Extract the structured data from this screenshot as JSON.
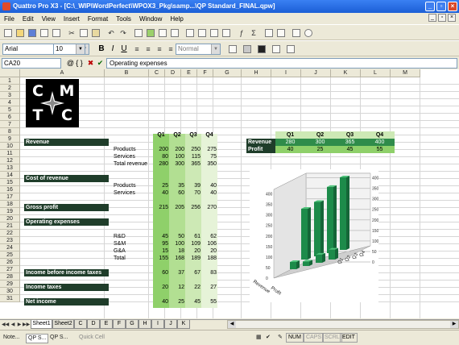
{
  "window": {
    "title": "Quattro Pro X3 - [C:\\_WIP\\WordPerfect\\WPOX3_Pkg\\samp...\\QP Standard_FINAL.qpw]"
  },
  "menu": [
    "File",
    "Edit",
    "View",
    "Insert",
    "Format",
    "Tools",
    "Window",
    "Help"
  ],
  "toolbar": {
    "font": "Arial",
    "size": "10",
    "style": "Normal",
    "bold": "B",
    "italic": "I",
    "underline": "U"
  },
  "input": {
    "cell_ref": "C A20",
    "cell_ref_text": "CA20",
    "at": "@",
    "braces": "{ }",
    "cancel": "✖",
    "confirm": "✔",
    "formula": "Operating expenses"
  },
  "columns": [
    "A",
    "B",
    "C",
    "D",
    "E",
    "F",
    "G",
    "H",
    "I",
    "J",
    "K",
    "L",
    "M"
  ],
  "rows": [
    "1",
    "2",
    "3",
    "4",
    "5",
    "6",
    "7",
    "8",
    "9",
    "10",
    "11",
    "12",
    "13",
    "14",
    "15",
    "16",
    "17",
    "18",
    "19",
    "20",
    "21",
    "22",
    "23",
    "24",
    "25",
    "26",
    "27",
    "28",
    "29",
    "30",
    "31"
  ],
  "logo": {
    "letters": [
      "C",
      "M",
      "T",
      "C"
    ]
  },
  "sheet": {
    "headers": [
      "Q1",
      "Q2",
      "Q3",
      "Q4"
    ],
    "revenue_label": "Revenue",
    "products_label": "Products",
    "services_label": "Services",
    "total_revenue_label": "Total revenue",
    "products_values": [
      "200",
      "200",
      "250",
      "275"
    ],
    "services_values": [
      "80",
      "100",
      "115",
      "75"
    ],
    "total_revenue_values": [
      "280",
      "300",
      "365",
      "350"
    ],
    "cost_label": "Cost of revenue",
    "cost_products_values": [
      "25",
      "35",
      "39",
      "40"
    ],
    "cost_services_values": [
      "40",
      "60",
      "70",
      "40"
    ],
    "gross_label": "Gross profit",
    "gross_values": [
      "215",
      "205",
      "256",
      "270"
    ],
    "opex_label": "Operating expenses",
    "rd_label": "R&D",
    "sm_label": "S&M",
    "ga_label": "G&A",
    "total_label": "Total",
    "rd_values": [
      "45",
      "50",
      "61",
      "62"
    ],
    "sm_values": [
      "95",
      "100",
      "109",
      "106"
    ],
    "ga_values": [
      "15",
      "18",
      "20",
      "20"
    ],
    "total_values": [
      "155",
      "168",
      "189",
      "188"
    ],
    "ebit_label": "Income before income taxes",
    "ebit_values": [
      "60",
      "37",
      "67",
      "83"
    ],
    "tax_label": "Income taxes",
    "tax_values": [
      "20",
      "12",
      "22",
      "27"
    ],
    "net_label": "Net income",
    "net_values": [
      "40",
      "25",
      "45",
      "55"
    ]
  },
  "summary": {
    "headers": [
      "Q1",
      "Q2",
      "Q3",
      "Q4"
    ],
    "revenue_label": "Revenue",
    "revenue_values": [
      "280",
      "300",
      "365",
      "400"
    ],
    "profit_label": "Profit",
    "profit_values": [
      "40",
      "25",
      "45",
      "55"
    ]
  },
  "chart_data": {
    "type": "bar",
    "categories": [
      "Q1",
      "Q2",
      "Q3",
      "Q4"
    ],
    "series": [
      {
        "name": "Revenue",
        "values": [
          280,
          300,
          365,
          400
        ]
      },
      {
        "name": "Profit",
        "values": [
          40,
          25,
          45,
          55
        ]
      }
    ],
    "ylim": [
      0,
      400
    ],
    "yticks": [
      "0",
      "50",
      "100",
      "150",
      "200",
      "250",
      "300",
      "350",
      "400"
    ],
    "style": "3d"
  },
  "tabs": [
    "Sheet1",
    "Sheet2",
    "C",
    "D",
    "E",
    "F",
    "G",
    "H",
    "I",
    "J",
    "K"
  ],
  "status": {
    "items": [
      "Note...",
      "QP S...",
      "QP S...",
      "Quick Cell"
    ],
    "num": "NUM",
    "caps": "CAPS",
    "scrl": "SCRL",
    "mode": "EDIT"
  },
  "colors": {
    "band": "#1f3d2a",
    "q_column": "#8fd06a",
    "chart_bar": "#2aa05a"
  }
}
